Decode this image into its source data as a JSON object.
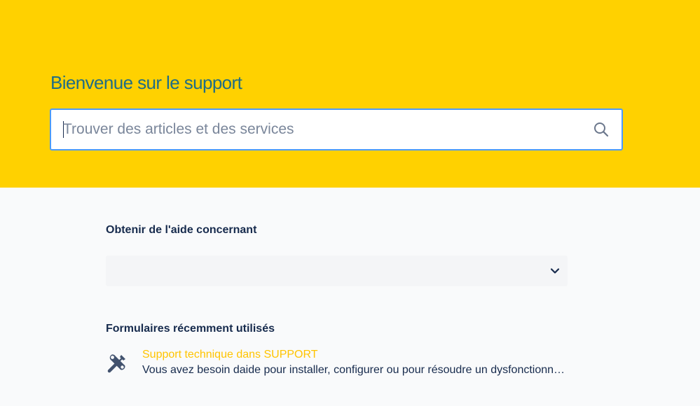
{
  "hero": {
    "title": "Bienvenue sur le support",
    "background_color": "#ffd100",
    "title_color": "#1f6d86"
  },
  "search": {
    "placeholder": "Trouver des articles et des services",
    "value": "",
    "icon": "search-icon"
  },
  "help": {
    "label": "Obtenir de l'aide concernant",
    "selected_value": "",
    "icon": "chevron-down-icon"
  },
  "recent_forms": {
    "label": "Formulaires récemment utilisés",
    "items": [
      {
        "icon": "tools-icon",
        "title": "Support technique dans SUPPORT",
        "description": "Vous avez besoin daide pour installer, configurer ou pour résoudre un dysfonctionnement",
        "title_color": "#ffc400"
      }
    ]
  }
}
